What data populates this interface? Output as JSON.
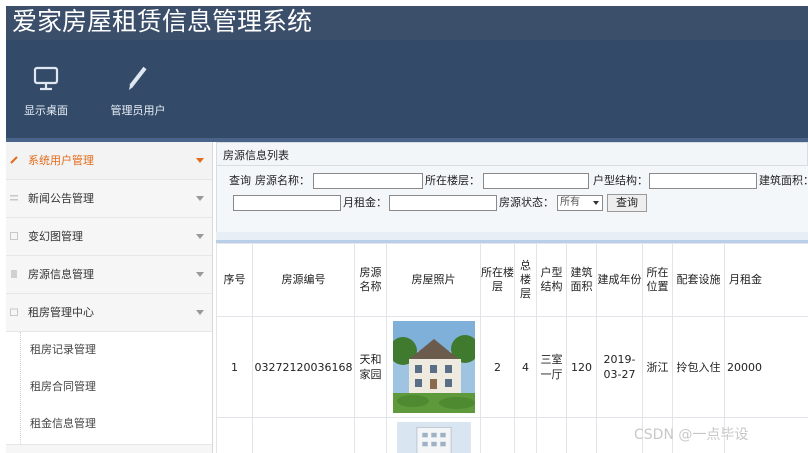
{
  "app": {
    "title": "爱家房屋租赁信息管理系统"
  },
  "toolbar": {
    "items": [
      {
        "label": "显示桌面",
        "icon": "monitor-icon"
      },
      {
        "label": "管理员用户",
        "icon": "pencil-icon"
      }
    ]
  },
  "sidebar": {
    "items": [
      {
        "label": "系统用户管理",
        "active": true
      },
      {
        "label": "新闻公告管理"
      },
      {
        "label": "变幻图管理"
      },
      {
        "label": "房源信息管理"
      },
      {
        "label": "租房管理中心"
      }
    ],
    "subitems": [
      {
        "label": "租房记录管理"
      },
      {
        "label": "租房合同管理"
      },
      {
        "label": "租金信息管理"
      }
    ]
  },
  "main": {
    "panel_title": "房源信息列表",
    "search": {
      "query_label": "查询",
      "name_label": "房源名称：",
      "floor_label": "所在楼层：",
      "structure_label": "户型结构：",
      "area_label": "建筑面积：",
      "rent_label": "月租金：",
      "status_label": "房源状态：",
      "status_value": "所有",
      "query_button": "查询"
    },
    "table": {
      "headers": [
        "序号",
        "房源编号",
        "房源名称",
        "房屋照片",
        "所在楼层",
        "总楼层",
        "户型结构",
        "建筑面积",
        "建成年份",
        "所在位置",
        "配套设施",
        "月租金"
      ],
      "rows": [
        [
          "1",
          "03272120036168",
          "天和家园",
          "",
          "2",
          "4",
          "三室一厅",
          "120",
          "2019-03-27",
          "浙江",
          "拎包入住",
          "20000"
        ]
      ]
    }
  },
  "watermark": "CSDN @一点毕设",
  "colors": {
    "header": "#3b4f6b",
    "toolbar": "#334a68",
    "active": "#e36b1b",
    "table_bar": "#b9cfe8"
  }
}
